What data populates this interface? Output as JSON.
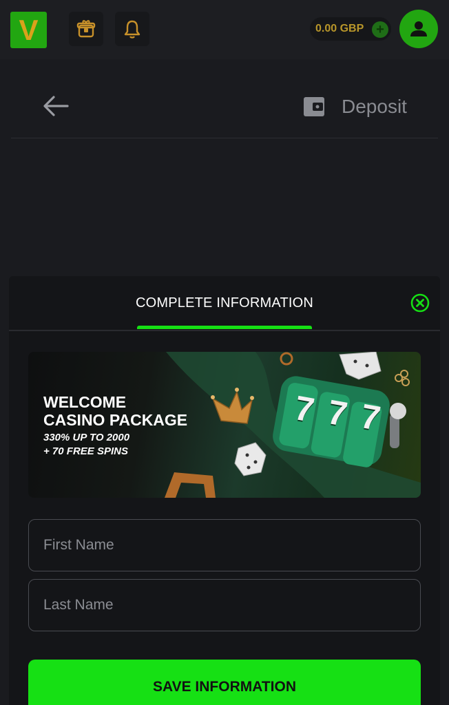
{
  "header": {
    "logo_text": "V",
    "balance": "0.00 GBP",
    "balance_add": "+"
  },
  "nav": {
    "deposit_label": "Deposit"
  },
  "modal": {
    "title": "COMPLETE INFORMATION",
    "banner": {
      "title_line1": "WELCOME",
      "title_line2": "CASINO PACKAGE",
      "sub_line1": "330% UP TO 2000",
      "sub_line2": "+ 70 FREE SPINS",
      "slot_digits": [
        "7",
        "7",
        "7"
      ]
    },
    "first_name_placeholder": "First Name",
    "last_name_placeholder": "Last Name",
    "save_label": "SAVE INFORMATION"
  },
  "colors": {
    "accent_green": "#16e014",
    "brand_green": "#22a611",
    "gold": "#b8962a",
    "background": "#1a1b1f"
  },
  "icons": [
    "gift-icon",
    "bell-icon",
    "plus-icon",
    "user-icon",
    "back-arrow-icon",
    "wallet-icon",
    "close-icon"
  ]
}
